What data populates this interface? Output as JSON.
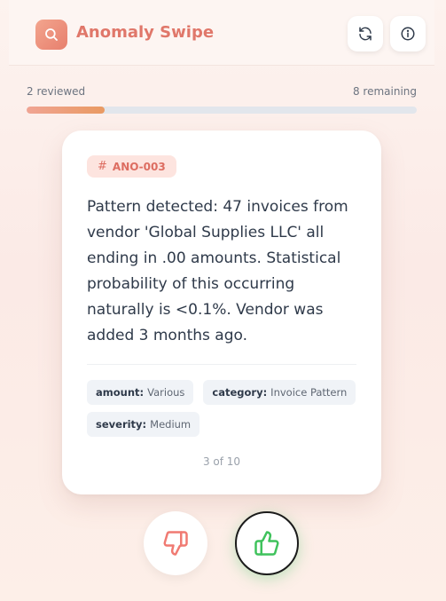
{
  "app": {
    "title": "Anomaly Swipe",
    "logo_icon": "search-icon",
    "accent_color": "#e0776a"
  },
  "header": {
    "buttons": [
      {
        "icon": "refresh-icon"
      },
      {
        "icon": "info-icon"
      }
    ]
  },
  "progress": {
    "reviewed_text": "2 reviewed",
    "remaining_text": "8 remaining",
    "fraction": 0.2
  },
  "card": {
    "id_prefix": "#",
    "id": "ANO-003",
    "description": "Pattern detected: 47 invoices from vendor 'Global Supplies LLC' all ending in .00 amounts. Statistical probability of this occurring naturally is <0.1%. Vendor was added 3 months ago.",
    "tags": [
      {
        "key": "amount:",
        "value": "Various"
      },
      {
        "key": "category:",
        "value": "Invoice Pattern"
      },
      {
        "key": "severity:",
        "value": "Medium"
      }
    ],
    "counter": "3 of 10"
  },
  "actions": {
    "dislike_icon": "thumbs-down-icon",
    "like_icon": "thumbs-up-icon",
    "dislike_color": "#f07a72",
    "like_color": "#3fc25c"
  }
}
